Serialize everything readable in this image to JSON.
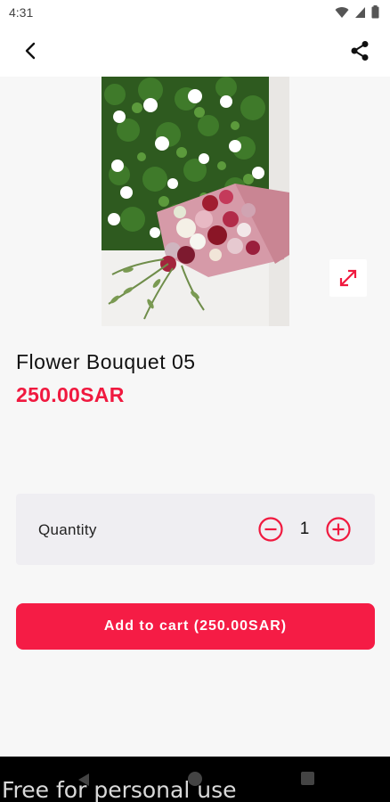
{
  "status_bar": {
    "time": "4:31"
  },
  "app_bar": {
    "back_icon": "arrow-back-icon",
    "share_icon": "share-icon"
  },
  "product": {
    "name": "Flower Bouquet 05",
    "price": "250.00SAR",
    "expand_icon": "expand-arrows-icon"
  },
  "quantity": {
    "label": "Quantity",
    "value": "1"
  },
  "add_to_cart": {
    "label": "Add to cart (250.00SAR)"
  },
  "watermark": "Free for personal use",
  "colors": {
    "accent": "#f51c45",
    "price": "#f0193f",
    "card_bg": "#efeef2"
  }
}
